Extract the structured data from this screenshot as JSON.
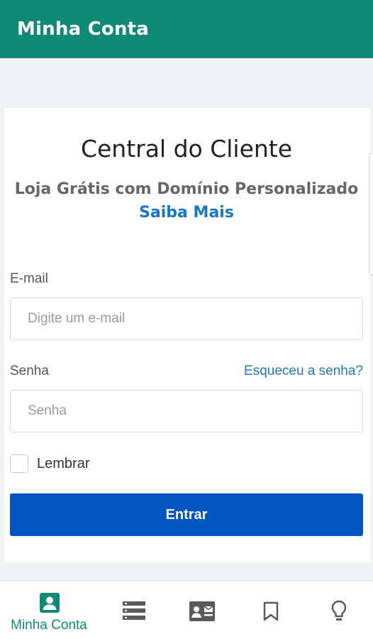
{
  "app_bar": {
    "title": "Minha Conta"
  },
  "main": {
    "heading": "Central do Cliente",
    "promo_text": "Loja Grátis com Domínio Personalizado",
    "promo_link": "Saiba Mais"
  },
  "form": {
    "email_label": "E-mail",
    "email_placeholder": "Digite um e-mail",
    "password_label": "Senha",
    "password_placeholder": "Senha",
    "forgot_link": "Esqueceu a senha?",
    "remember_label": "Lembrar",
    "submit_label": "Entrar"
  },
  "bottom_nav": {
    "items": [
      {
        "icon": "account-box-icon",
        "label": "Minha Conta",
        "active": true
      },
      {
        "icon": "list-icon",
        "active": false
      },
      {
        "icon": "contact-card-icon",
        "active": false
      },
      {
        "icon": "bookmark-icon",
        "active": false
      },
      {
        "icon": "lightbulb-icon",
        "active": false
      }
    ]
  },
  "colors": {
    "primary": "#0f8a76",
    "button": "#0055c0",
    "link": "#1976c4",
    "icon_inactive": "#5a5a5a"
  }
}
